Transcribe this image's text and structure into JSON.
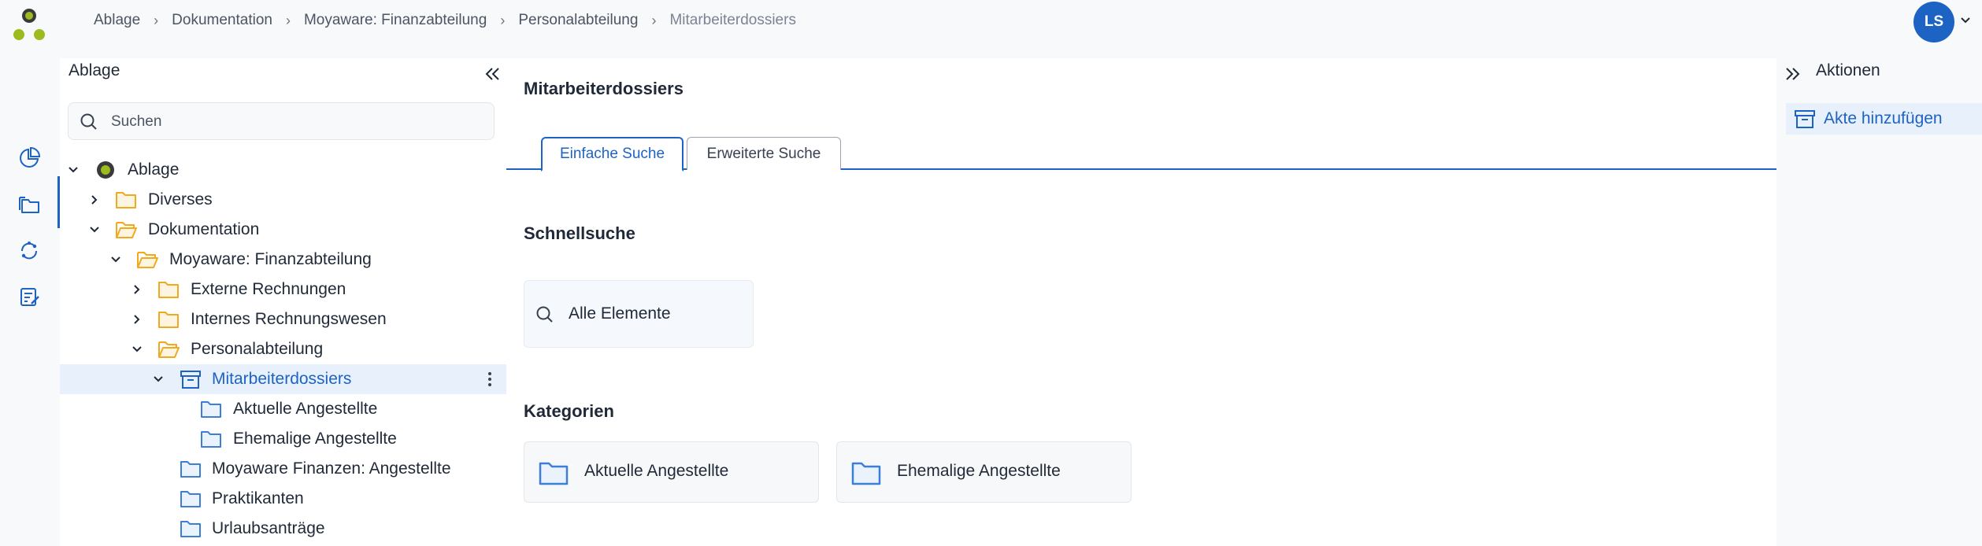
{
  "colors": {
    "accent": "#1d63c4",
    "folder_yellow": "#f2a91c",
    "folder_blue": "#3d7fd6",
    "logo_green": "#9bbb1f"
  },
  "breadcrumb": [
    "Ablage",
    "Dokumentation",
    "Moyaware: Finanzabteilung",
    "Personalabteilung",
    "Mitarbeiterdossiers"
  ],
  "user": {
    "initials": "LS"
  },
  "rail": {
    "icons": [
      "dashboard-icon",
      "folders-icon",
      "sync-icon",
      "tasks-icon"
    ],
    "active": "folders-icon"
  },
  "tree_panel": {
    "title": "Ablage",
    "search_placeholder": "Suchen",
    "items": [
      {
        "label": "Ablage",
        "icon": "root-logo-icon",
        "expanded": true
      },
      {
        "label": "Diverses",
        "icon": "folder-yellow-icon",
        "expanded": false
      },
      {
        "label": "Dokumentation",
        "icon": "folder-open-yellow-icon",
        "expanded": true
      },
      {
        "label": "Moyaware: Finanzabteilung",
        "icon": "folder-open-yellow-icon",
        "expanded": true
      },
      {
        "label": "Externe Rechnungen",
        "icon": "folder-yellow-icon",
        "expanded": false
      },
      {
        "label": "Internes Rechnungswesen",
        "icon": "folder-yellow-icon",
        "expanded": false
      },
      {
        "label": "Personalabteilung",
        "icon": "folder-open-yellow-icon",
        "expanded": true
      },
      {
        "label": "Mitarbeiterdossiers",
        "icon": "archive-box-icon",
        "expanded": true,
        "selected": true
      },
      {
        "label": "Aktuelle Angestellte",
        "icon": "folder-blue-icon"
      },
      {
        "label": "Ehemalige Angestellte",
        "icon": "folder-blue-icon"
      },
      {
        "label": "Moyaware Finanzen: Angestellte",
        "icon": "folder-blue-icon"
      },
      {
        "label": "Praktikanten",
        "icon": "folder-blue-icon"
      },
      {
        "label": "Urlaubsanträge",
        "icon": "folder-blue-icon"
      }
    ]
  },
  "main": {
    "title": "Mitarbeiterdossiers",
    "tabs": [
      {
        "label": "Einfache Suche",
        "active": true
      },
      {
        "label": "Erweiterte Suche",
        "active": false
      }
    ],
    "quick_search": {
      "title": "Schnellsuche",
      "item": "Alle Elemente"
    },
    "categories": {
      "title": "Kategorien",
      "items": [
        "Aktuelle Angestellte",
        "Ehemalige Angestellte"
      ]
    }
  },
  "actions": {
    "title": "Aktionen",
    "items": [
      {
        "label": "Akte hinzufügen",
        "icon": "archive-box-icon"
      }
    ]
  }
}
